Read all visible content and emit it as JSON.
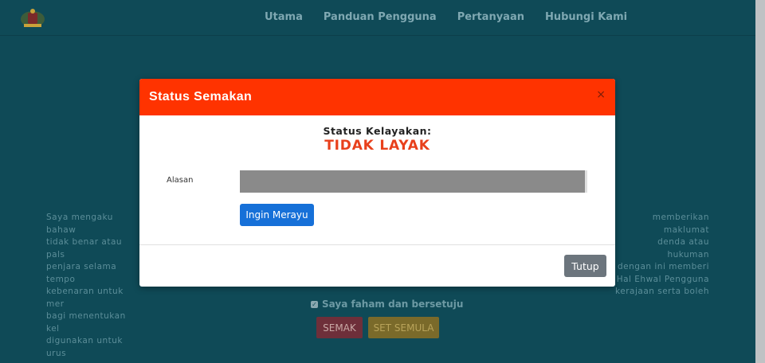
{
  "nav": {
    "items": [
      "Utama",
      "Panduan Pengguna",
      "Pertanyaan",
      "Hubungi Kami"
    ]
  },
  "background": {
    "declaration_lines": [
      "Saya mengaku bahaw",
      "memberikan maklumat",
      "tidak benar atau pals",
      "denda atau hukuman",
      "penjara selama tempo",
      "dengan ini memberi",
      "kebenaran untuk mer",
      "Hal Ehwal Pengguna",
      "bagi menentukan kel",
      "kerajaan serta boleh",
      "digunakan untuk urus"
    ],
    "agree_label": "Saya faham dan bersetuju",
    "semak_label": "SEMAK",
    "reset_label": "SET SEMULA"
  },
  "modal": {
    "title": "Status Semakan",
    "close_symbol": "×",
    "status_label": "Status Kelayakan:",
    "status_value": "TIDAK LAYAK",
    "reason_label": "Alasan",
    "reason_value": "",
    "appeal_label": "Ingin Merayu",
    "close_label": "Tutup"
  },
  "colors": {
    "header": "#ff3300",
    "status_value": "#e8401c",
    "primary": "#1670d8",
    "secondary": "#6c757d",
    "page_bg": "#0f4a57"
  }
}
